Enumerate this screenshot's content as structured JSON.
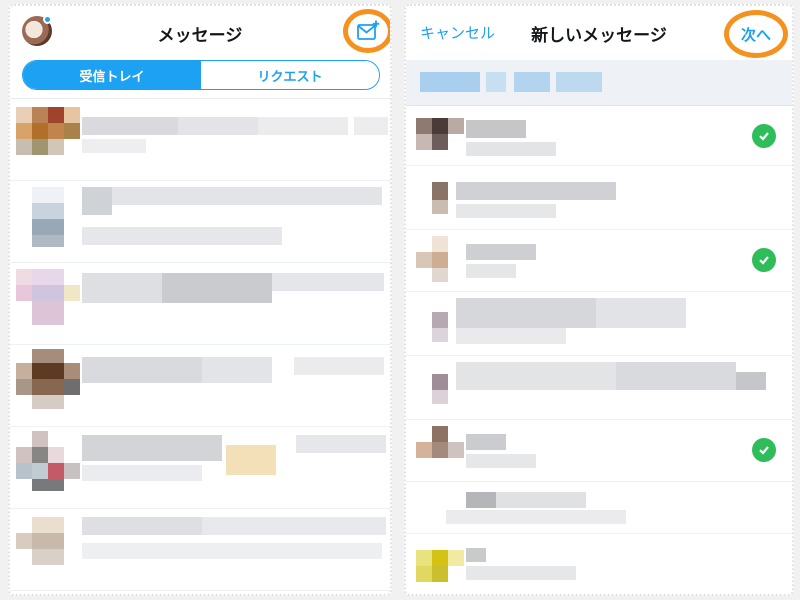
{
  "inbox": {
    "title": "メッセージ",
    "tabs": [
      {
        "label": "受信トレイ",
        "active": true
      },
      {
        "label": "リクエスト",
        "active": false
      }
    ],
    "compose_icon": "compose-mail-icon",
    "avatar_icon": "profile-avatar",
    "row_count": 6
  },
  "new_message": {
    "cancel_label": "キャンセル",
    "title": "新しいメッセージ",
    "next_label": "次へ",
    "selected_check_icon": "checkmark-icon",
    "rows": [
      {
        "selected": true
      },
      {
        "selected": false
      },
      {
        "selected": true
      },
      {
        "selected": false
      },
      {
        "selected": false
      },
      {
        "selected": true
      },
      {
        "selected": false
      },
      {
        "selected": false
      }
    ]
  },
  "colors": {
    "accent": "#1da1f2",
    "highlight": "#f5921f",
    "check": "#2ebd59"
  }
}
